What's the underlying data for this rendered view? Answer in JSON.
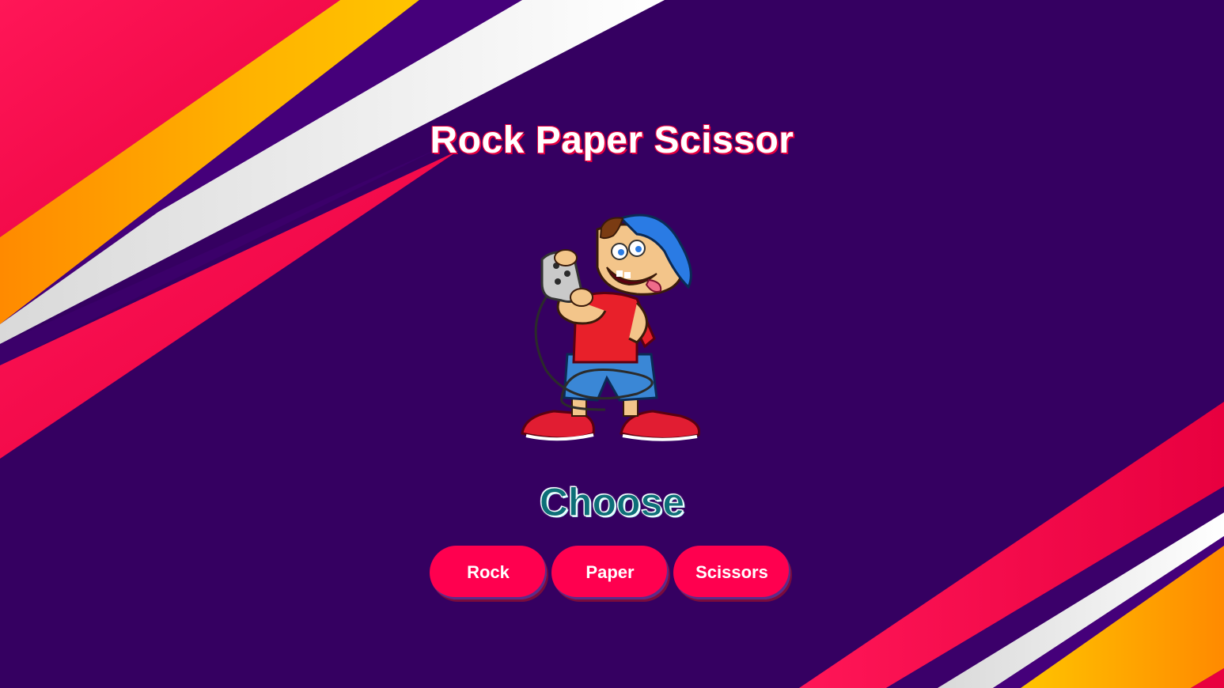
{
  "app": {
    "title": "Rock Paper Scissor",
    "prompt": "Choose"
  },
  "illustration": {
    "name": "gamer-boy-illustration",
    "alt": ""
  },
  "choices": [
    {
      "label": "Rock"
    },
    {
      "label": "Paper"
    },
    {
      "label": "Scissors"
    }
  ],
  "colors": {
    "background": "#350061",
    "accent_red": "#ff004f",
    "accent_orange": "#ffb300",
    "stripe_white": "#f2f2f2",
    "choose_text": "#0d6f78"
  }
}
